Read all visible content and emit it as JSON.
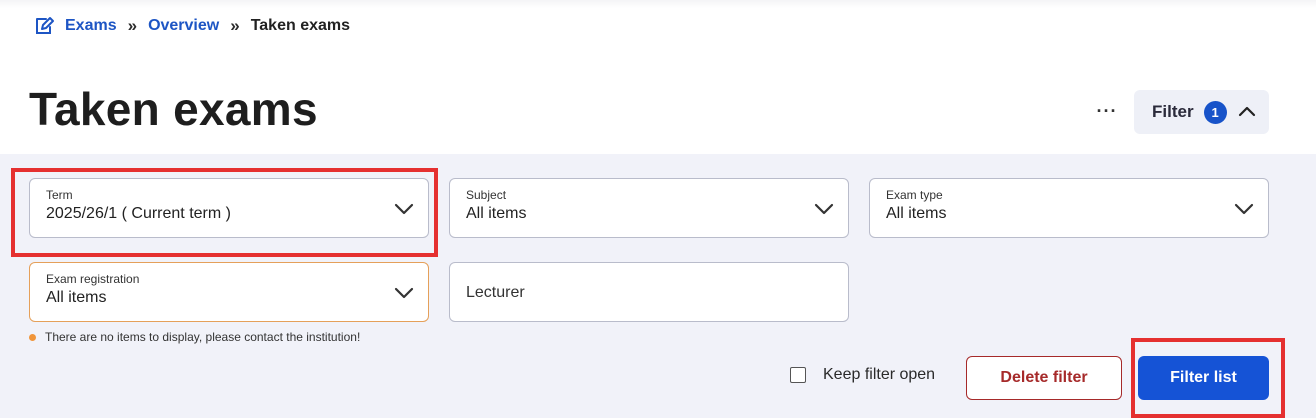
{
  "breadcrumb": {
    "icon": "edit-exam-icon",
    "items": [
      "Exams",
      "Overview",
      "Taken exams"
    ],
    "separator": "»"
  },
  "header": {
    "title": "Taken exams",
    "more_label": "···",
    "filter_label": "Filter",
    "filter_count": "1"
  },
  "filters": {
    "term": {
      "label": "Term",
      "value": "2025/26/1 ( Current term )"
    },
    "subject": {
      "label": "Subject",
      "value": "All items"
    },
    "exam_type": {
      "label": "Exam type",
      "value": "All items"
    },
    "exam_registration": {
      "label": "Exam registration",
      "value": "All items"
    },
    "lecturer": {
      "placeholder": "Lecturer"
    },
    "notice": "There are no items to display, please contact the institution!",
    "keep_open_label": "Keep filter open",
    "keep_open_checked": false,
    "delete_label": "Delete filter",
    "apply_label": "Filter list"
  },
  "colors": {
    "accent": "#1553d6",
    "link": "#1d55c4",
    "danger": "#a62a2a",
    "highlight": "#e53030",
    "warning": "#f0953a",
    "panel_bg": "#f1f2f9"
  }
}
